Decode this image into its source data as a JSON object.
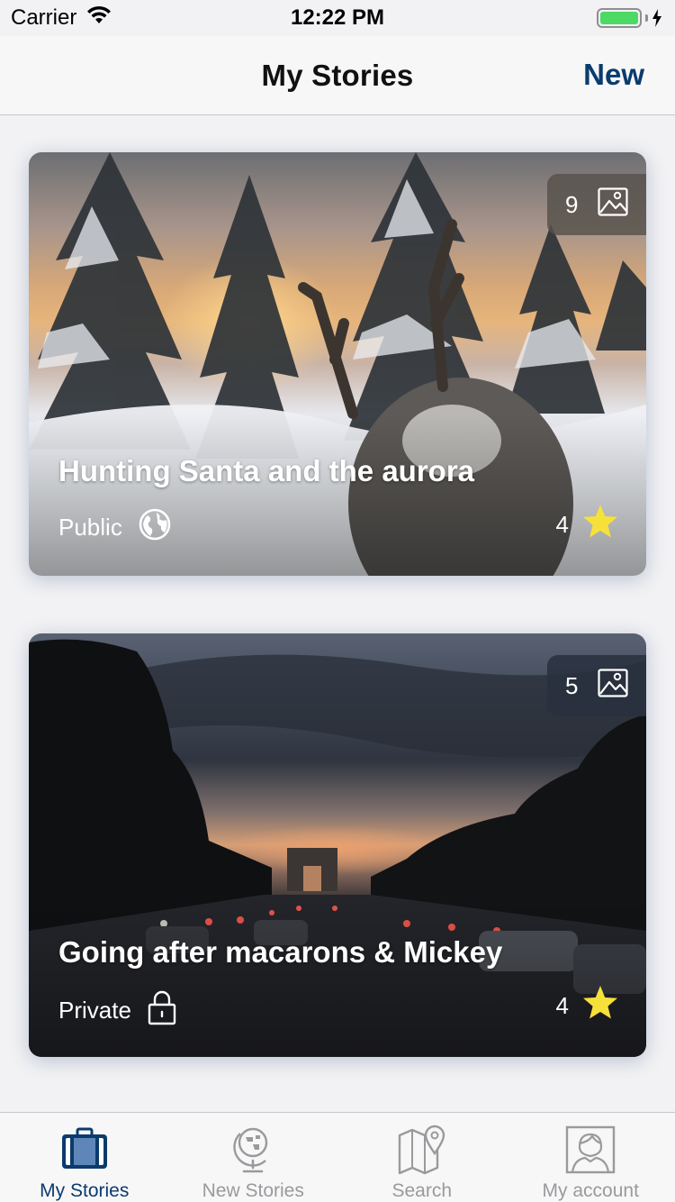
{
  "status_bar": {
    "carrier": "Carrier",
    "time": "12:22 PM",
    "icons": [
      "wifi-icon",
      "battery-icon",
      "charging-bolt-icon"
    ]
  },
  "nav": {
    "title": "My Stories",
    "new_label": "New"
  },
  "colors": {
    "accent": "#0b3b6e",
    "star": "#f6e13a",
    "battery": "#4cd964",
    "tab_inactive": "#9a9a9e"
  },
  "stories": [
    {
      "title": "Hunting Santa and the aurora",
      "visibility": "Public",
      "visibility_icon": "globe-icon",
      "photo_count": "9",
      "rating": "4",
      "image": "snowy-forest-reindeer-sunset"
    },
    {
      "title": "Going after macarons & Mickey",
      "visibility": "Private",
      "visibility_icon": "lock-icon",
      "photo_count": "5",
      "rating": "4",
      "image": "dusk-avenue-arc-de-triomphe"
    }
  ],
  "tabs": [
    {
      "label": "My Stories",
      "icon": "suitcase-icon",
      "active": true
    },
    {
      "label": "New Stories",
      "icon": "globe-stand-icon",
      "active": false
    },
    {
      "label": "Search",
      "icon": "map-pin-icon",
      "active": false
    },
    {
      "label": "My account",
      "icon": "user-portrait-icon",
      "active": false
    }
  ]
}
